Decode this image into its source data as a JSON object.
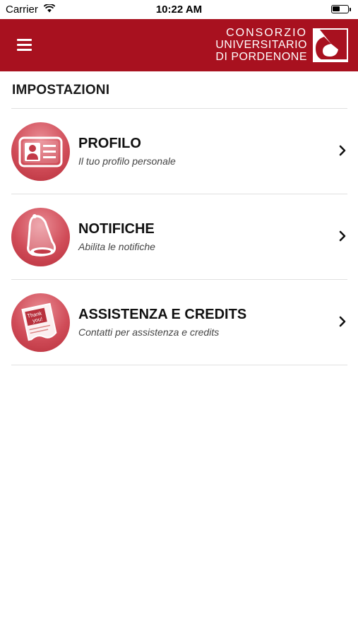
{
  "status_bar": {
    "carrier": "Carrier",
    "time": "10:22 AM",
    "battery_level": 0.5
  },
  "header": {
    "background_color": "#a8111f",
    "logo_lines": [
      "CONSORZIO",
      "UNIVERSITARIO",
      "DI PORDENONE"
    ],
    "menu_icon": "hamburger-icon"
  },
  "page": {
    "title": "IMPOSTAZIONI"
  },
  "settings": [
    {
      "title": "PROFILO",
      "subtitle": "Il tuo profilo personale",
      "icon": "id-card-icon"
    },
    {
      "title": "NOTIFICHE",
      "subtitle": "Abilita le notifiche",
      "icon": "bell-icon"
    },
    {
      "title": "ASSISTENZA E CREDITS",
      "subtitle": "Contatti per assistenza e credits",
      "icon": "thank-you-note-icon",
      "icon_text": [
        "Thank",
        "you!"
      ]
    }
  ],
  "colors": {
    "accent": "#a8111f",
    "icon_circle": "#d04c58",
    "divider": "#e0e0e0"
  }
}
